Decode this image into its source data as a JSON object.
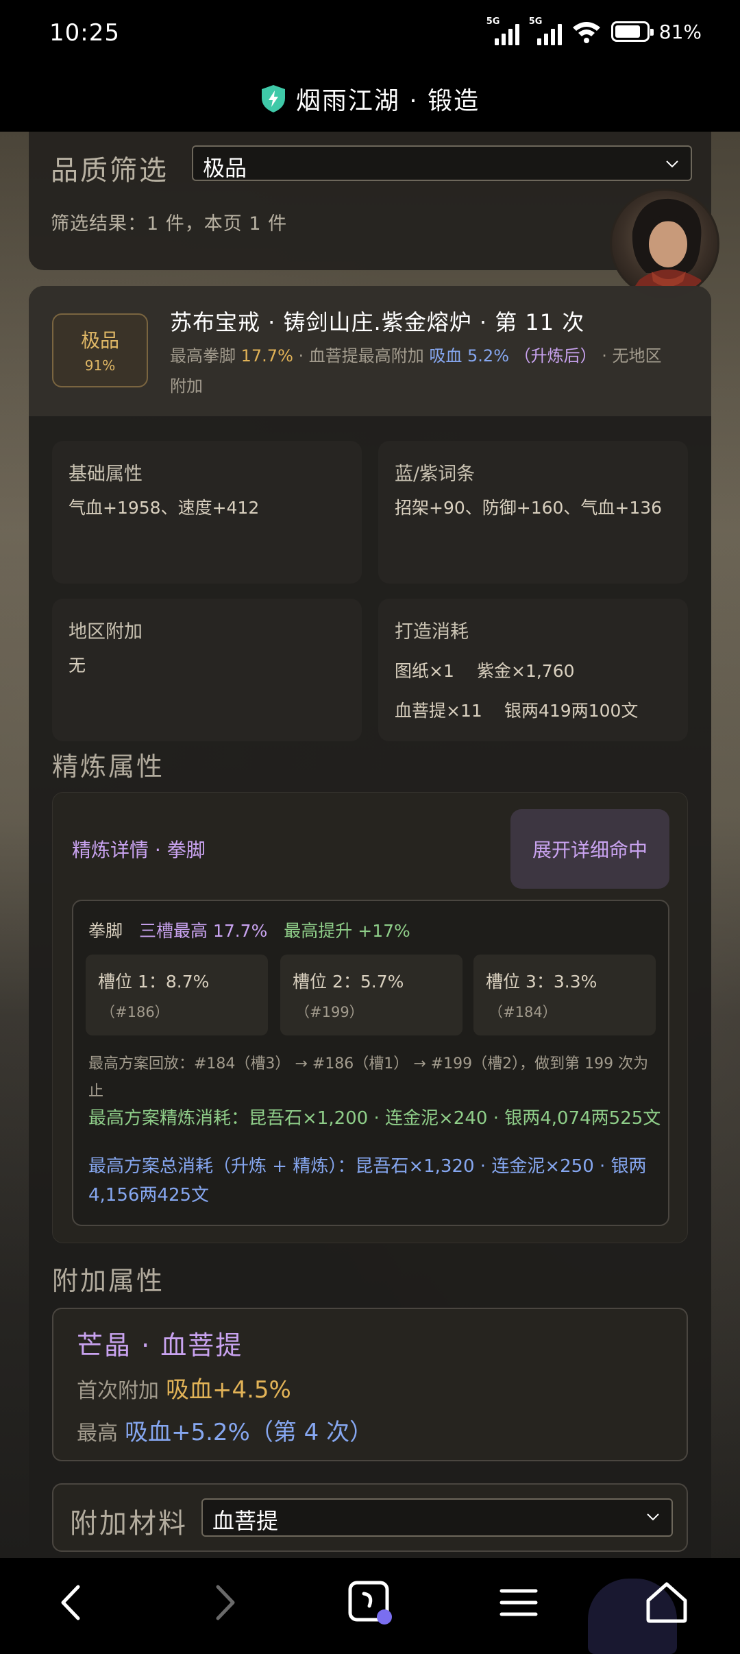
{
  "status_bar": {
    "time": "10:25",
    "signal1": "5G",
    "signal2": "5G",
    "battery": "81%"
  },
  "title_bar": {
    "title": "烟雨江湖 · 锻造"
  },
  "filter": {
    "label": "品质筛选",
    "selected": "极品",
    "result": "筛选结果：1 件，本页 1 件"
  },
  "item": {
    "grade": "极品",
    "grade_pct": "91%",
    "title": "苏布宝戒 · 铸剑山庄.紫金熔炉 · 第 11 次",
    "sub_prefix": "最高拳脚",
    "sub_pct": "17.7%",
    "sub_mid": " · 血菩提最高附加 ",
    "sub_blood": "吸血 5.2%",
    "sub_after": "（升炼后）",
    "sub_tail": " · 无地区附加"
  },
  "stats": {
    "base_label": "基础属性",
    "base_value": "气血+1958、速度+412",
    "affix_label": "蓝/紫词条",
    "affix_value": "招架+90、防御+160、气血+136",
    "region_label": "地区附加",
    "region_value": "无",
    "cost_label": "打造消耗",
    "cost_items": [
      "图纸×1",
      "紫金×1,760",
      "血菩提×11",
      "银两419两100文"
    ]
  },
  "refine": {
    "section_title": "精炼属性",
    "detail_label": "精炼详情 · 拳脚",
    "expand_button": "展开详细命中",
    "stat_name": "拳脚",
    "slot3_max": "三槽最高 17.7%",
    "max_increase": "最高提升 +17%",
    "slots": [
      {
        "value": "槽位 1：8.7%",
        "id": "（#186）"
      },
      {
        "value": "槽位 2：5.7%",
        "id": "（#199）"
      },
      {
        "value": "槽位 3：3.3%",
        "id": "（#184）"
      }
    ],
    "replay": "最高方案回放：#184（槽3） → #186（槽1） → #199（槽2），做到第 199 次为止",
    "cost_refine": "最高方案精炼消耗：昆吾石×1,200 · 连金泥×240 · 银两4,074两525文",
    "cost_total": "最高方案总消耗（升炼 + 精炼）：昆吾石×1,320 · 连金泥×250 · 银两4,156两425文"
  },
  "extra": {
    "section_title": "附加属性",
    "name": "芒晶 · 血菩提",
    "first_label": "首次附加",
    "first_value": "吸血+4.5%",
    "max_label": "最高",
    "max_value": "吸血+5.2%（第 4 次）"
  },
  "material": {
    "label": "附加材料",
    "selected": "血菩提"
  },
  "icons": {
    "shield": "shield-bolt-icon",
    "back": "chevron-left-icon",
    "forward": "chevron-right-icon",
    "tabs": "tabs-icon",
    "menu": "menu-icon",
    "home": "home-icon"
  },
  "colors": {
    "gold": "#e2b357",
    "blue": "#86a7f0",
    "purple": "#c9a3f0",
    "green": "#8fce89",
    "shield": "#3fc9a8"
  }
}
